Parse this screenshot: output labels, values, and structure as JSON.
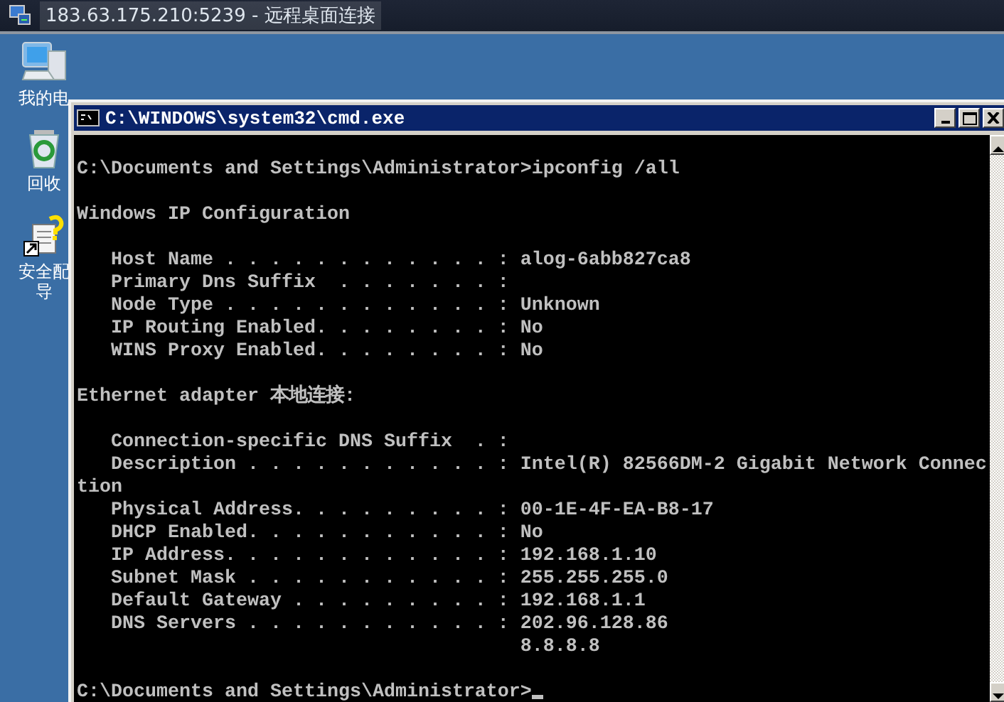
{
  "remote_window": {
    "title": "183.63.175.210:5239 - 远程桌面连接"
  },
  "desktop_icons": [
    {
      "kind": "computer",
      "label": "我的电"
    },
    {
      "kind": "recycle",
      "label": "回收"
    },
    {
      "kind": "wizard",
      "label": "安全配导"
    }
  ],
  "cmd_window": {
    "title": "C:\\WINDOWS\\system32\\cmd.exe",
    "lines": [
      {
        "kind": "text",
        "text": "C:\\Documents and Settings\\Administrator>ipconfig /all"
      },
      {
        "kind": "blank"
      },
      {
        "kind": "text",
        "text": "Windows IP Configuration"
      },
      {
        "kind": "blank"
      },
      {
        "kind": "text",
        "text": "   Host Name . . . . . . . . . . . . : alog-6abb827ca8"
      },
      {
        "kind": "text",
        "text": "   Primary Dns Suffix  . . . . . . . :"
      },
      {
        "kind": "text",
        "text": "   Node Type . . . . . . . . . . . . : Unknown"
      },
      {
        "kind": "text",
        "text": "   IP Routing Enabled. . . . . . . . : No"
      },
      {
        "kind": "text",
        "text": "   WINS Proxy Enabled. . . . . . . . : No"
      },
      {
        "kind": "blank"
      },
      {
        "kind": "text",
        "text": "Ethernet adapter 本地连接:"
      },
      {
        "kind": "blank"
      },
      {
        "kind": "text",
        "text": "   Connection-specific DNS Suffix  . :"
      },
      {
        "kind": "text",
        "text": "   Description . . . . . . . . . . . : Intel(R) 82566DM-2 Gigabit Network Connec"
      },
      {
        "kind": "text",
        "text": "tion"
      },
      {
        "kind": "text",
        "text": "   Physical Address. . . . . . . . . : 00-1E-4F-EA-B8-17"
      },
      {
        "kind": "text",
        "text": "   DHCP Enabled. . . . . . . . . . . : No"
      },
      {
        "kind": "text",
        "text": "   IP Address. . . . . . . . . . . . : 192.168.1.10"
      },
      {
        "kind": "text",
        "text": "   Subnet Mask . . . . . . . . . . . : 255.255.255.0"
      },
      {
        "kind": "text",
        "text": "   Default Gateway . . . . . . . . . : 192.168.1.1"
      },
      {
        "kind": "text",
        "text": "   DNS Servers . . . . . . . . . . . : 202.96.128.86"
      },
      {
        "kind": "text",
        "text": "                                       8.8.8.8"
      },
      {
        "kind": "blank"
      },
      {
        "kind": "text",
        "text": "C:\\Documents and Settings\\Administrator>",
        "cursor": true
      }
    ]
  }
}
